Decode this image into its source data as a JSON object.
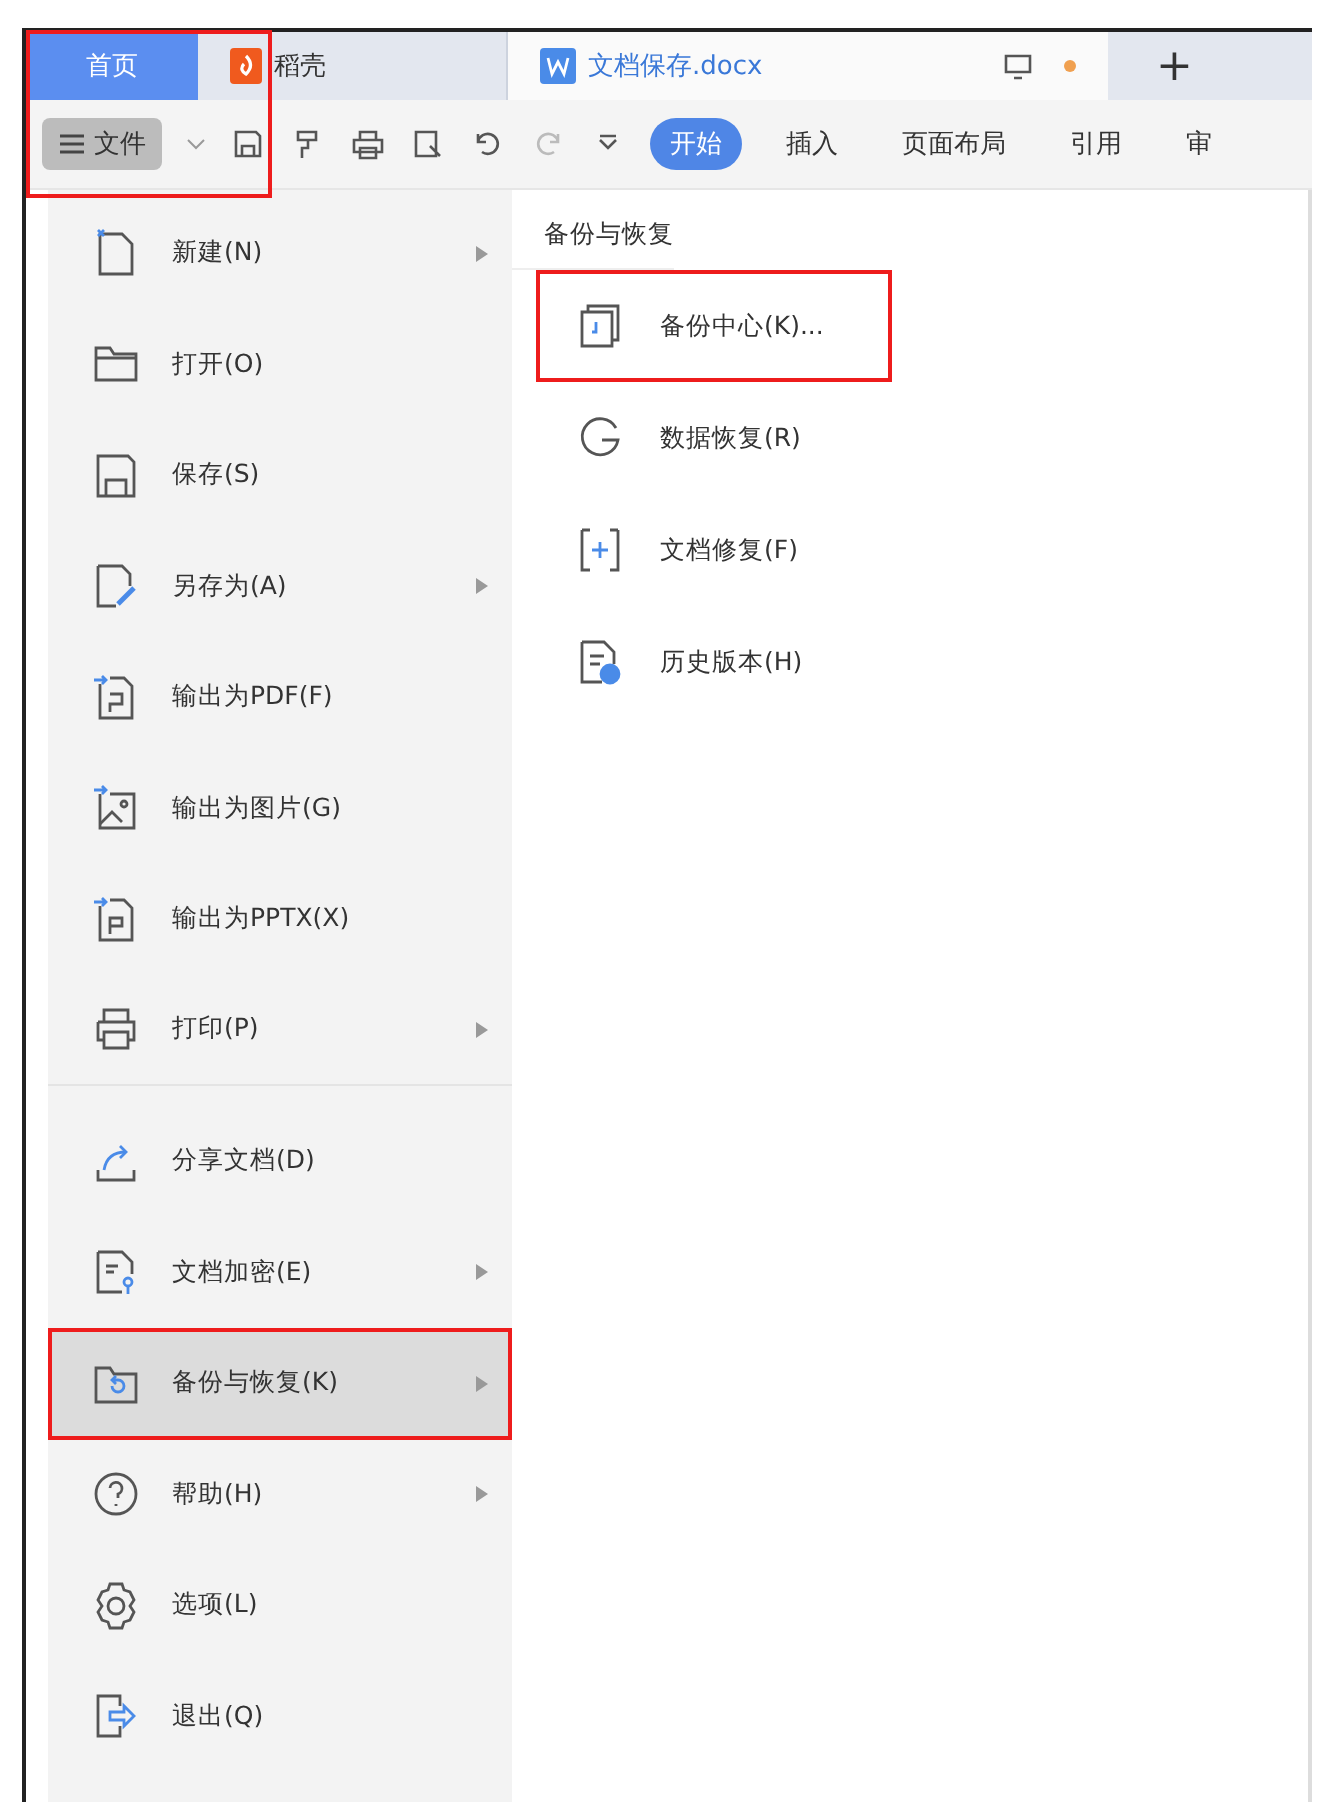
{
  "tabs": [
    {
      "label": "首页",
      "kind": "home",
      "selected": false
    },
    {
      "label": "稻壳",
      "kind": "docer",
      "selected": false
    },
    {
      "label": "文档保存.docx",
      "kind": "document",
      "selected": true
    }
  ],
  "tab_add": "+",
  "header_highlighted": true,
  "toolbar": {
    "file_button": "文件",
    "ribbon_tabs": [
      {
        "label": "开始",
        "selected": true
      },
      {
        "label": "插入",
        "selected": false
      },
      {
        "label": "页面布局",
        "selected": false
      },
      {
        "label": "引用",
        "selected": false
      },
      {
        "label": "审",
        "selected": false
      }
    ]
  },
  "file_menu": {
    "items": [
      {
        "label": "新建(N)",
        "submenu": true,
        "selected": false,
        "highlighted": false
      },
      {
        "label": "打开(O)",
        "submenu": false,
        "selected": false,
        "highlighted": false
      },
      {
        "label": "保存(S)",
        "submenu": false,
        "selected": false,
        "highlighted": false
      },
      {
        "label": "另存为(A)",
        "submenu": true,
        "selected": false,
        "highlighted": false
      },
      {
        "label": "输出为PDF(F)",
        "submenu": false,
        "selected": false,
        "highlighted": false
      },
      {
        "label": "输出为图片(G)",
        "submenu": false,
        "selected": false,
        "highlighted": false
      },
      {
        "label": "输出为PPTX(X)",
        "submenu": false,
        "selected": false,
        "highlighted": false
      },
      {
        "label": "打印(P)",
        "submenu": true,
        "selected": false,
        "highlighted": false,
        "divider_after": true
      },
      {
        "label": "分享文档(D)",
        "submenu": false,
        "selected": false,
        "highlighted": false
      },
      {
        "label": "文档加密(E)",
        "submenu": true,
        "selected": false,
        "highlighted": false
      },
      {
        "label": "备份与恢复(K)",
        "submenu": true,
        "selected": true,
        "highlighted": true
      },
      {
        "label": "帮助(H)",
        "submenu": true,
        "selected": false,
        "highlighted": false
      },
      {
        "label": "选项(L)",
        "submenu": false,
        "selected": false,
        "highlighted": false
      },
      {
        "label": "退出(Q)",
        "submenu": false,
        "selected": false,
        "highlighted": false
      }
    ]
  },
  "submenu": {
    "title": "备份与恢复",
    "items": [
      {
        "label": "备份中心(K)...",
        "highlighted": true
      },
      {
        "label": "数据恢复(R)",
        "highlighted": false
      },
      {
        "label": "文档修复(F)",
        "highlighted": false
      },
      {
        "label": "历史版本(H)",
        "highlighted": false
      }
    ]
  }
}
